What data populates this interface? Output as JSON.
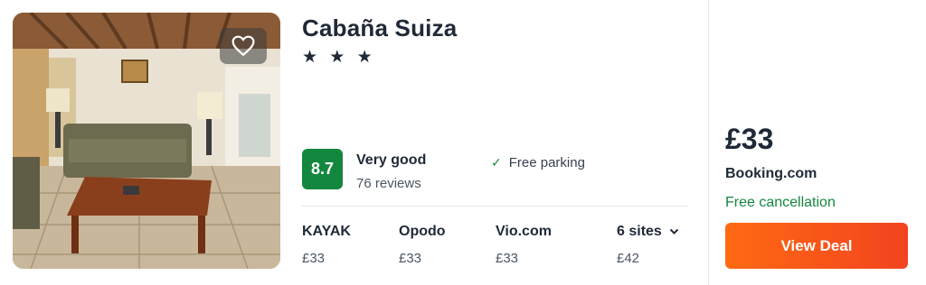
{
  "hotel": {
    "name": "Cabaña Suiza",
    "stars": "★ ★ ★",
    "score": "8.7",
    "rating_label": "Very good",
    "reviews": "76 reviews",
    "amenity": "Free parking",
    "favorite_icon": "heart-outline-icon"
  },
  "providers": [
    {
      "name": "KAYAK",
      "price": "£33"
    },
    {
      "name": "Opodo",
      "price": "£33"
    },
    {
      "name": "Vio.com",
      "price": "£33"
    },
    {
      "name": "6 sites",
      "price": "£42"
    }
  ],
  "best_deal": {
    "price": "£33",
    "site": "Booking.com",
    "cancellation": "Free cancellation",
    "button_label": "View Deal"
  },
  "colors": {
    "score_bg": "#14873f",
    "cancel_text": "#14873f",
    "button_start": "#ff6a13",
    "button_end": "#f2431f"
  }
}
